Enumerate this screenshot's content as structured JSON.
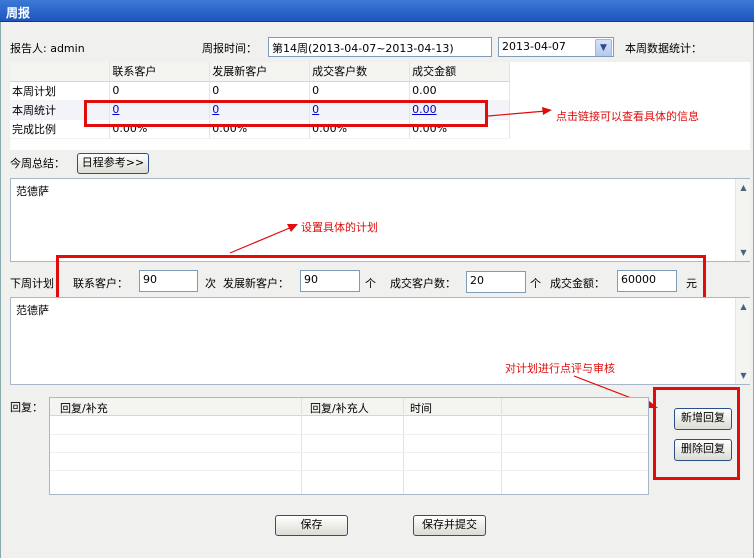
{
  "window": {
    "title": "周报"
  },
  "header": {
    "reporter_label": "报告人: admin",
    "report_time_label": "周报时间：",
    "week_value": "第14周(2013-04-07~2013-04-13)",
    "date_value": "2013-04-07",
    "stats_label": "本周数据统计："
  },
  "stats": {
    "columns": [
      "联系客户",
      "发展新客户",
      "成交客户数",
      "成交金额"
    ],
    "rows": [
      {
        "label": "本周计划",
        "values": [
          "0",
          "0",
          "0",
          "0.00"
        ]
      },
      {
        "label": "本周统计",
        "values": [
          "0",
          "0",
          "0",
          "0.00"
        ]
      },
      {
        "label": "完成比例",
        "values": [
          "0.00%",
          "0.00%",
          "0.00%",
          "0.00%"
        ]
      }
    ]
  },
  "summary": {
    "label": "今周总结：",
    "schedule_button": "日程参考>>",
    "text": "范德萨"
  },
  "next_plan": {
    "label": "下周计划：",
    "contact_label": "联系客户：",
    "contact_value": "90",
    "contact_unit": "次",
    "new_label": "发展新客户：",
    "new_value": "90",
    "new_unit": "个",
    "deal_label": "成交客户数：",
    "deal_value": "20",
    "deal_unit": "个",
    "amount_label": "成交金额：",
    "amount_value": "60000",
    "amount_unit": "元",
    "text": "范德萨"
  },
  "reply": {
    "label": "回复：",
    "columns": [
      "回复/补充",
      "回复/补充人",
      "时间"
    ],
    "add_button": "新增回复",
    "delete_button": "删除回复"
  },
  "footer": {
    "save_button": "保存",
    "save_submit_button": "保存并提交"
  },
  "annotations": {
    "link_note": "点击链接可以查看具体的信息",
    "plan_note": "设置具体的计划",
    "review_note": "对计划进行点评与审核"
  },
  "colors": {
    "annotation": "#e10d0d",
    "titlebar": "#1d55bf",
    "link": "#0000cc"
  }
}
